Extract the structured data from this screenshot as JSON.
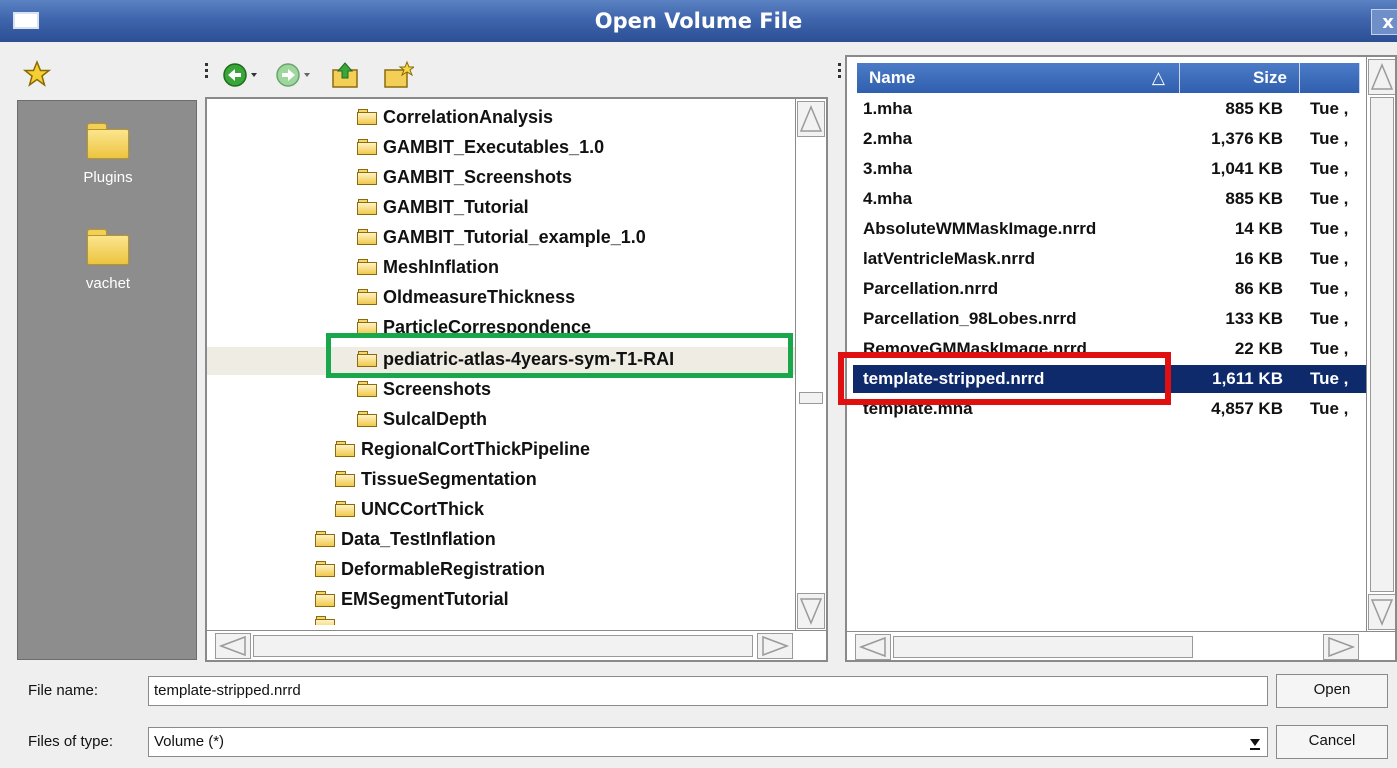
{
  "window": {
    "title": "Open Volume File",
    "close_glyph": "x"
  },
  "places": {
    "items": [
      {
        "label": "Plugins",
        "icon": "folder-icon"
      },
      {
        "label": "vachet",
        "icon": "folder-icon"
      }
    ]
  },
  "toolbar": {
    "icons": [
      "bookmark-star-icon",
      "back-arrow-icon",
      "forward-arrow-icon",
      "up-folder-icon",
      "new-folder-icon"
    ]
  },
  "tree": {
    "items": [
      {
        "label": "CorrelationAnalysis"
      },
      {
        "label": "GAMBIT_Executables_1.0"
      },
      {
        "label": "GAMBIT_Screenshots"
      },
      {
        "label": "GAMBIT_Tutorial"
      },
      {
        "label": "GAMBIT_Tutorial_example_1.0"
      },
      {
        "label": "MeshInflation"
      },
      {
        "label": "OldmeasureThickness"
      },
      {
        "label": "ParticleCorrespondence"
      },
      {
        "label": "pediatric-atlas-4years-sym-T1-RAI"
      },
      {
        "label": "Screenshots"
      },
      {
        "label": "SulcalDepth"
      },
      {
        "label": "RegionalCortThickPipeline"
      },
      {
        "label": "TissueSegmentation"
      },
      {
        "label": "UNCCortThick"
      },
      {
        "label": "Data_TestInflation"
      },
      {
        "label": "DeformableRegistration"
      },
      {
        "label": "EMSegmentTutorial"
      }
    ]
  },
  "filelist": {
    "columns": {
      "name": "Name",
      "size": "Size",
      "sort_glyph": "△"
    },
    "rows": [
      {
        "name": "1.mha",
        "size": "885 KB",
        "date": "Tue ,"
      },
      {
        "name": "2.mha",
        "size": "1,376 KB",
        "date": "Tue ,"
      },
      {
        "name": "3.mha",
        "size": "1,041 KB",
        "date": "Tue ,"
      },
      {
        "name": "4.mha",
        "size": "885 KB",
        "date": "Tue ,"
      },
      {
        "name": "AbsoluteWMMaskImage.nrrd",
        "size": "14 KB",
        "date": "Tue ,"
      },
      {
        "name": "latVentricleMask.nrrd",
        "size": "16 KB",
        "date": "Tue ,"
      },
      {
        "name": "Parcellation.nrrd",
        "size": "86 KB",
        "date": "Tue ,"
      },
      {
        "name": "Parcellation_98Lobes.nrrd",
        "size": "133 KB",
        "date": "Tue ,"
      },
      {
        "name": "RemoveGMMaskImage.nrrd",
        "size": "22 KB",
        "date": "Tue ,"
      },
      {
        "name": "template-stripped.nrrd",
        "size": "1,611 KB",
        "date": "Tue ,"
      },
      {
        "name": "template.mha",
        "size": "4,857 KB",
        "date": "Tue ,"
      }
    ]
  },
  "bottom": {
    "filename_label": "File name:",
    "filename_value": "template-stripped.nrrd",
    "filetype_label": "Files of type:",
    "filetype_value": "Volume (*)",
    "open_label": "Open",
    "cancel_label": "Cancel"
  },
  "highlights": {
    "green": "#1aa64a",
    "red": "#e01010",
    "selection": "#0e2a6b"
  }
}
